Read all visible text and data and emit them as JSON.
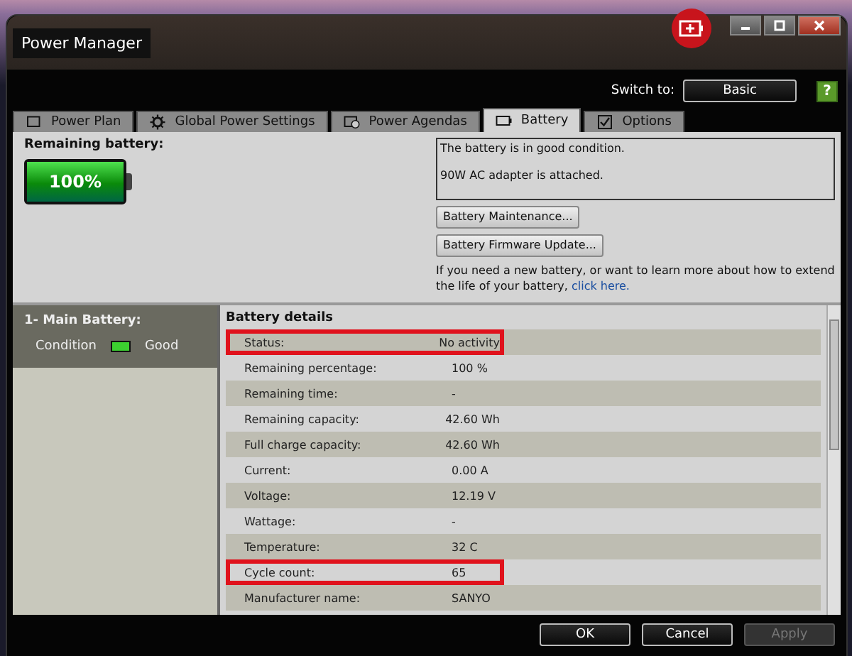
{
  "window": {
    "title": "Power Manager"
  },
  "switch_to": {
    "label": "Switch to:",
    "button": "Basic"
  },
  "help_button": "?",
  "tabs": [
    {
      "label": "Power Plan",
      "kind": "plan",
      "selected": false
    },
    {
      "label": "Global Power Settings",
      "kind": "settings",
      "selected": false
    },
    {
      "label": "Power Agendas",
      "kind": "agenda",
      "selected": false
    },
    {
      "label": "Battery",
      "kind": "battery",
      "selected": true
    },
    {
      "label": "Options",
      "kind": "options",
      "selected": false
    }
  ],
  "remaining": {
    "label": "Remaining battery:",
    "percent": "100%",
    "level": 1
  },
  "messages": [
    "The battery is in good condition.",
    "90W AC adapter is attached."
  ],
  "action_buttons": [
    "Battery Maintenance...",
    "Battery Firmware Update..."
  ],
  "help_text": "If you need a new battery, or want to learn more about how to extend the life of your battery, ",
  "help_link": "click here.",
  "batteries": [
    {
      "name": "1- Main Battery:",
      "condition_label": "Condition",
      "condition": "Good",
      "selected": true
    }
  ],
  "details": {
    "title": "Battery details",
    "rows": [
      {
        "label": "Status:",
        "value": "No activity",
        "highlighted": true
      },
      {
        "label": "Remaining percentage:",
        "value": "100 %",
        "highlighted": false
      },
      {
        "label": "Remaining time:",
        "value": "-",
        "highlighted": false
      },
      {
        "label": "Remaining capacity:",
        "value": "42.60 Wh",
        "highlighted": false
      },
      {
        "label": "Full charge capacity:",
        "value": "42.60 Wh",
        "highlighted": false
      },
      {
        "label": "Current:",
        "value": "0.00 A",
        "highlighted": false
      },
      {
        "label": "Voltage:",
        "value": "12.19 V",
        "highlighted": false
      },
      {
        "label": "Wattage:",
        "value": "-",
        "highlighted": false
      },
      {
        "label": "Temperature:",
        "value": "32 C",
        "highlighted": false
      },
      {
        "label": "Cycle count:",
        "value": "65",
        "highlighted": true
      },
      {
        "label": "Manufacturer name:",
        "value": "SANYO",
        "highlighted": false
      }
    ]
  },
  "footer_buttons": [
    {
      "label": "OK",
      "disabled": false
    },
    {
      "label": "Cancel",
      "disabled": false
    },
    {
      "label": "Apply",
      "disabled": true
    }
  ]
}
